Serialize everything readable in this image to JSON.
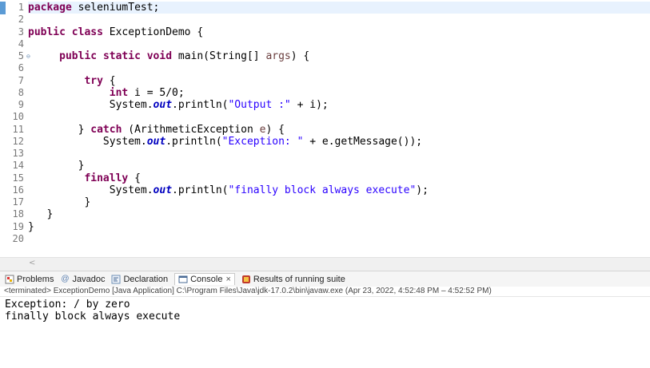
{
  "editor": {
    "line_numbers": [
      "1",
      "2",
      "3",
      "4",
      "5",
      "6",
      "7",
      "8",
      "9",
      "10",
      "11",
      "12",
      "13",
      "14",
      "15",
      "16",
      "17",
      "18",
      "19",
      "20"
    ],
    "code": {
      "l1": {
        "kw": "package",
        "rest": " seleniumTest;"
      },
      "l3": {
        "kw1": "public",
        "kw2": "class",
        "rest": " ExceptionDemo {"
      },
      "l5": {
        "kw1": "public",
        "kw2": "static",
        "kw3": "void",
        "pre": " main(String[] ",
        "param": "args",
        "post": ") {"
      },
      "l7": {
        "kw": "try",
        "rest": " {"
      },
      "l8": {
        "kw": "int",
        "rest": " i = 5/0;"
      },
      "l9": {
        "pre": "System.",
        "fld": "out",
        "mid": ".println(",
        "str": "\"Output :\"",
        "post": " + i);"
      },
      "l11": {
        "pre": "} ",
        "kw": "catch",
        "mid": " (ArithmeticException ",
        "param": "e",
        "post": ") {"
      },
      "l12": {
        "pre": "System.",
        "fld": "out",
        "mid": ".println(",
        "str": "\"Exception: \"",
        "post": " + e.getMessage());"
      },
      "l14": {
        "text": "}"
      },
      "l15": {
        "kw": "finally",
        "rest": " {"
      },
      "l16": {
        "pre": "System.",
        "fld": "out",
        "mid": ".println(",
        "str": "\"finally block always execute\"",
        "post": ");"
      },
      "l17": {
        "text": "}"
      },
      "l18": {
        "text": "}"
      },
      "l19": {
        "text": "}"
      }
    }
  },
  "scrollbar": {
    "left_arrow": "<"
  },
  "tabs": {
    "problems": "Problems",
    "javadoc": "Javadoc",
    "declaration": "Declaration",
    "console": "Console",
    "console_close": "×",
    "results": "Results of running suite"
  },
  "console_header": "<terminated> ExceptionDemo [Java Application] C:\\Program Files\\Java\\jdk-17.0.2\\bin\\javaw.exe  (Apr 23, 2022, 4:52:48 PM – 4:52:52 PM)",
  "console_output": [
    "Exception: / by zero",
    "finally block always execute"
  ],
  "colors": {
    "keyword": "#7f0055",
    "string": "#2a00ff",
    "field": "#0000c0",
    "current_line": "#e8f2fe"
  }
}
